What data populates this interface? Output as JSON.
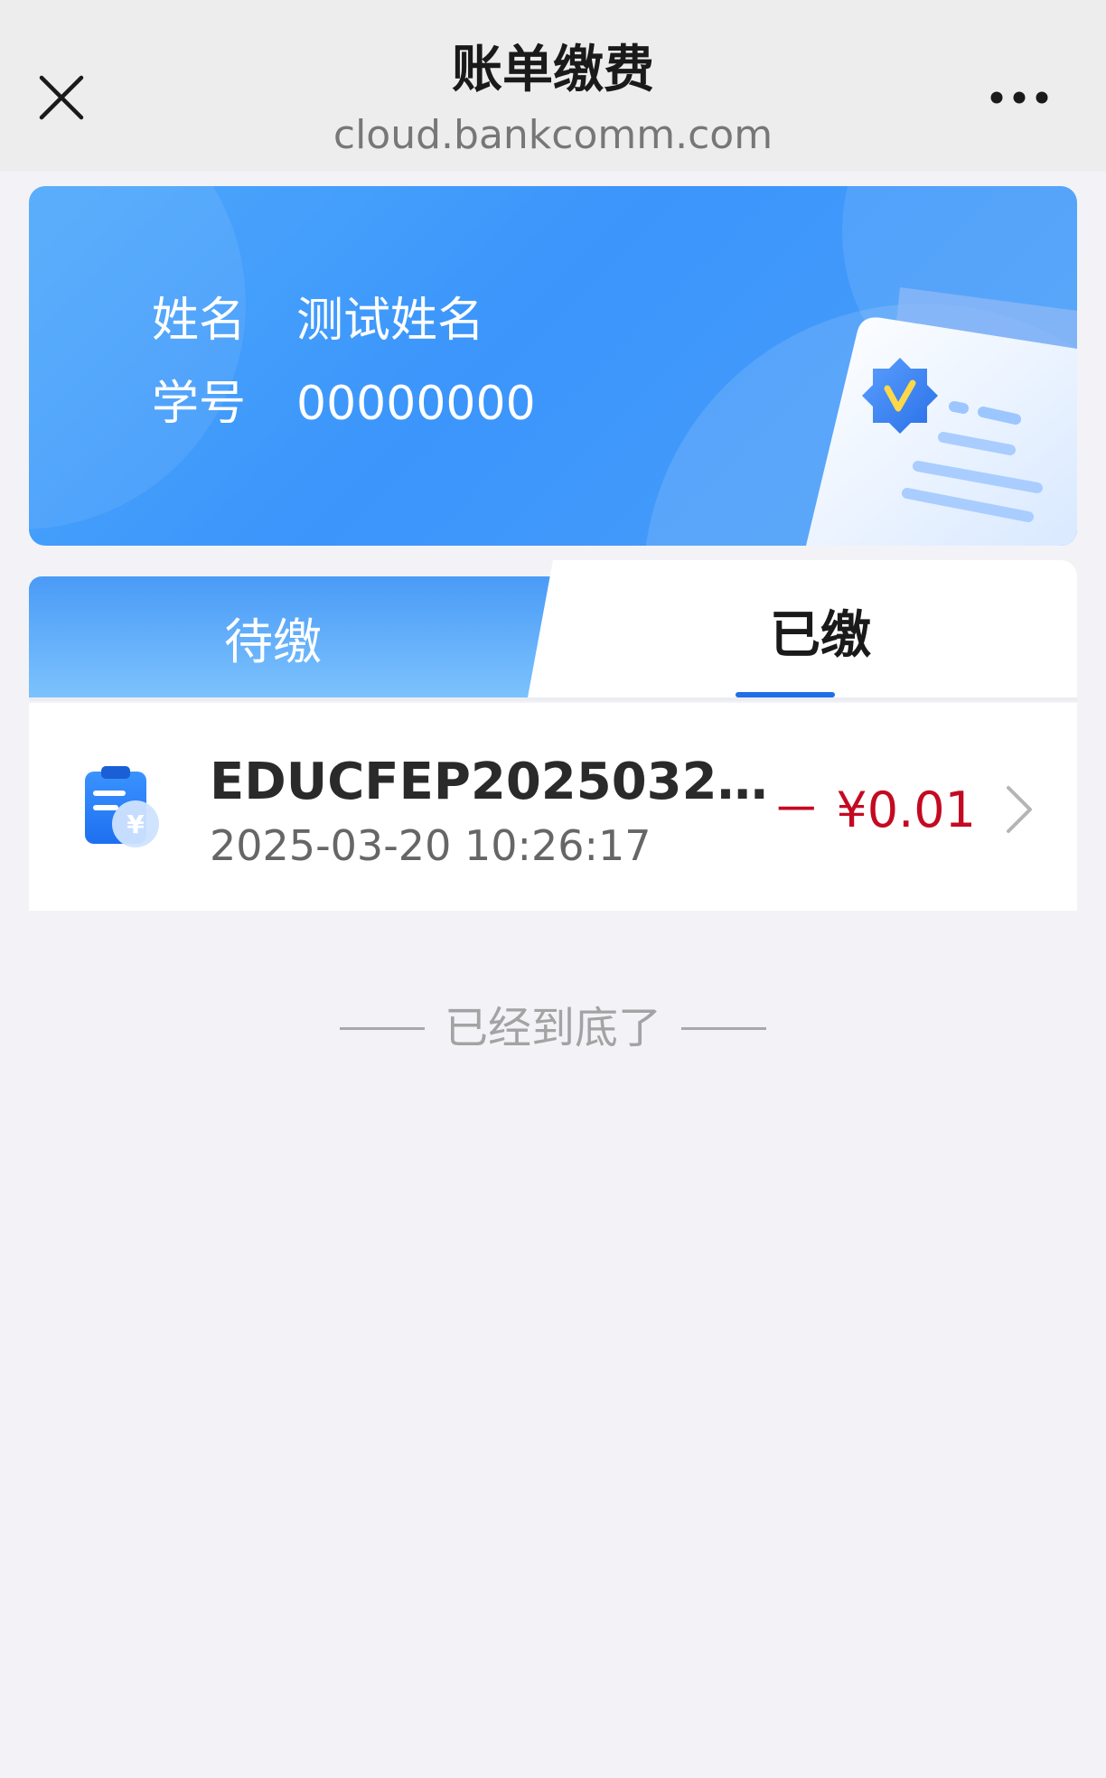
{
  "header": {
    "title": "账单缴费",
    "subtitle": "cloud.bankcomm.com",
    "close_icon": "close-icon",
    "more_icon": "more-horizontal-icon"
  },
  "student": {
    "name_label": "姓名",
    "name_value": "测试姓名",
    "id_label": "学号",
    "id_value": "00000000",
    "illustration_icon": "verified-card-icon"
  },
  "tabs": [
    {
      "label": "待缴",
      "active": false
    },
    {
      "label": "已缴",
      "active": true
    }
  ],
  "bills": [
    {
      "icon": "bill-clipboard-icon",
      "id": "EDUCFEP202503201...",
      "time": "2025-03-20 10:26:17",
      "amount": "－ ¥0.01"
    }
  ],
  "end_note": "已经到底了",
  "colors": {
    "accent_blue": "#3b95fb",
    "tab_underline": "#1f6fe8",
    "amount_red": "#c40a22",
    "page_bg": "#f3f3f7"
  }
}
